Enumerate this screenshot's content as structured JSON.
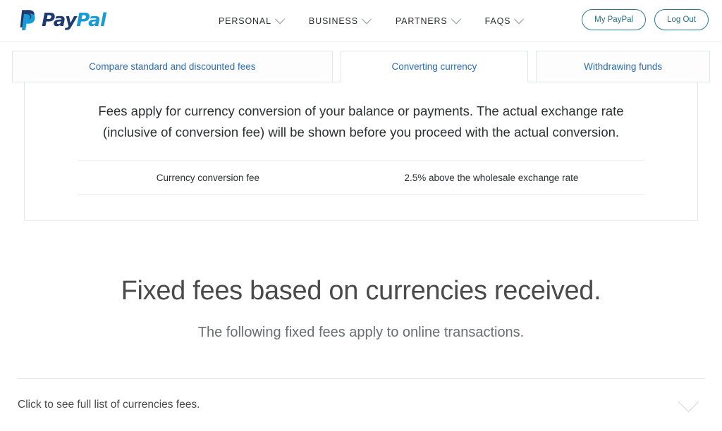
{
  "header": {
    "logo_text_part1": "Pay",
    "logo_text_part2": "Pal",
    "nav": [
      {
        "label": "PERSONAL",
        "icon": "chevron-down-icon"
      },
      {
        "label": "BUSINESS",
        "icon": "chevron-down-icon"
      },
      {
        "label": "PARTNERS",
        "icon": "chevron-down-icon"
      },
      {
        "label": "FAQS",
        "icon": "chevron-down-icon"
      }
    ],
    "my_paypal_label": "My PayPal",
    "log_out_label": "Log Out"
  },
  "tabs": [
    {
      "label": "Compare standard and discounted fees",
      "active": false
    },
    {
      "label": "Converting currency",
      "active": true
    },
    {
      "label": "Withdrawing funds",
      "active": false
    }
  ],
  "panel": {
    "intro": "Fees apply for currency conversion of your balance or payments. The actual exchange rate (inclusive of conversion fee) will be shown before you proceed with the actual conversion.",
    "fee_rows": [
      {
        "label": "Currency conversion fee",
        "value": "2.5% above the wholesale exchange rate"
      }
    ]
  },
  "section": {
    "title": "Fixed fees based on currencies received.",
    "subtitle": "The following fixed fees apply to online transactions."
  },
  "accordion": {
    "label": "Click to see full list of currencies fees.",
    "icon": "chevron-down-icon"
  },
  "colors": {
    "logo_navy": "#1f3a70",
    "logo_blue": "#179bd7",
    "tab_link": "#2b6cb0",
    "button_teal": "#26707f",
    "border": "#e3e7ea",
    "text": "#2c2e2f"
  }
}
